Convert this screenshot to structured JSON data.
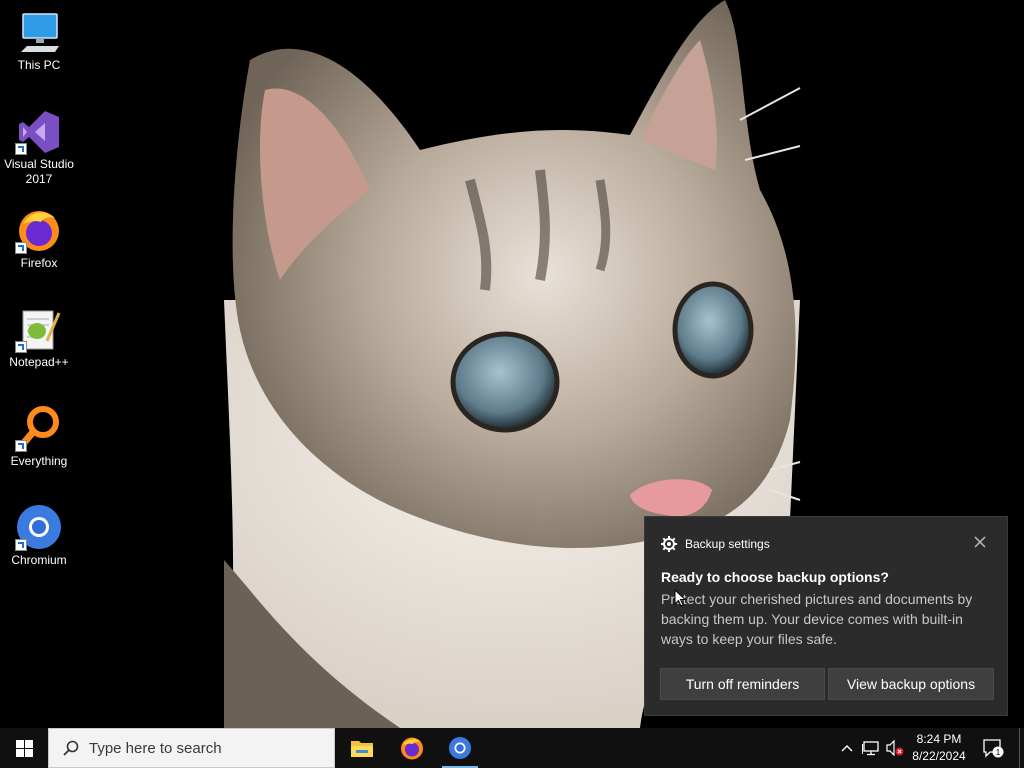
{
  "desktop": {
    "icons": [
      {
        "label": "This PC",
        "icon": "this-pc-icon"
      },
      {
        "label": "Visual Studio 2017",
        "icon": "visual-studio-icon"
      },
      {
        "label": "Firefox",
        "icon": "firefox-icon"
      },
      {
        "label": "Notepad++",
        "icon": "notepadpp-icon"
      },
      {
        "label": "Everything",
        "icon": "everything-icon"
      },
      {
        "label": "Chromium",
        "icon": "chromium-icon"
      }
    ]
  },
  "toast": {
    "app_name": "Backup settings",
    "title": "Ready to choose backup options?",
    "body": "Protect your cherished pictures and documents by backing them up. Your device comes with built-in ways to keep your files safe.",
    "button_left": "Turn off reminders",
    "button_right": "View backup options"
  },
  "taskbar": {
    "search_placeholder": "Type here to search",
    "pinned": [
      "file-explorer-icon",
      "firefox-icon",
      "chromium-icon"
    ],
    "clock_time": "8:24 PM",
    "clock_date": "8/22/2024",
    "notification_count": "1"
  },
  "colors": {
    "accent": "#76b9ed",
    "toast_bg": "#2b2b2b",
    "taskbar_bg": "#101010"
  }
}
